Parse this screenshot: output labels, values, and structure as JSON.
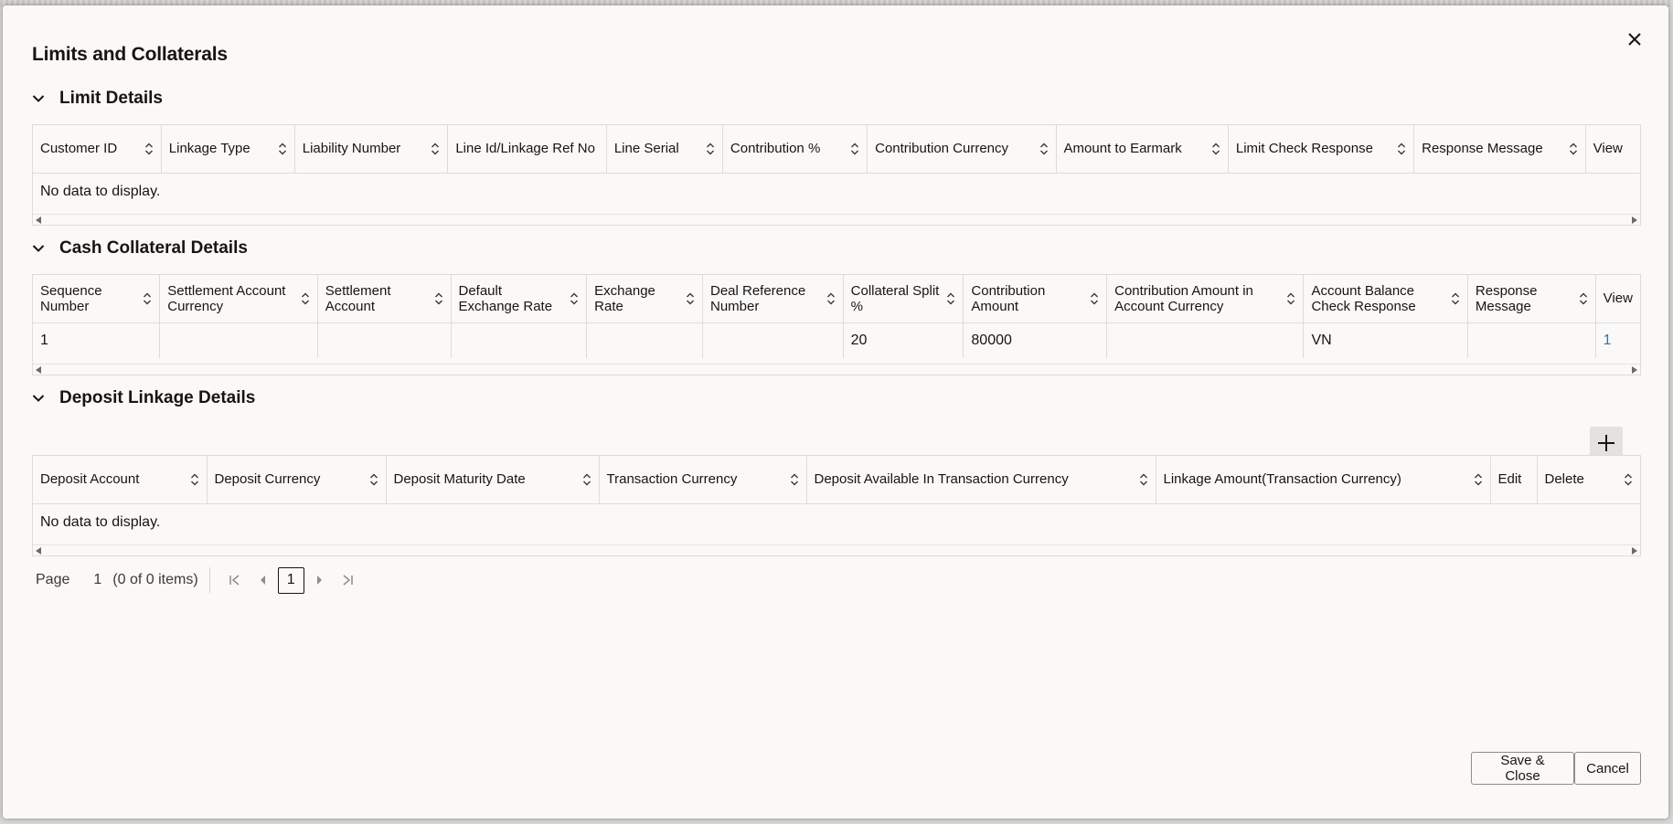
{
  "dialog": {
    "title": "Limits and Collaterals",
    "save_close_label": "Save & Close",
    "cancel_label": "Cancel"
  },
  "limit_details": {
    "title": "Limit Details",
    "columns": [
      "Customer ID",
      "Linkage Type",
      "Liability Number",
      "Line Id/Linkage Ref No",
      "Line Serial",
      "Contribution %",
      "Contribution Currency",
      "Amount to Earmark",
      "Limit Check Response",
      "Response Message",
      "View"
    ],
    "empty_text": "No data to display."
  },
  "cash_collateral": {
    "title": "Cash Collateral Details",
    "columns": [
      "Sequence Number",
      "Settlement Account Currency",
      "Settlement Account",
      "Default Exchange Rate",
      "Exchange Rate",
      "Deal Reference Number",
      "Collateral Split %",
      "Contribution Amount",
      "Contribution Amount in Account Currency",
      "Account Balance Check Response",
      "Response Message",
      "View"
    ],
    "rows": [
      [
        "1",
        "",
        "",
        "",
        "",
        "",
        "20",
        "80000",
        "",
        "VN",
        "",
        "1"
      ]
    ]
  },
  "deposit_linkage": {
    "title": "Deposit Linkage Details",
    "columns": [
      "Deposit Account",
      "Deposit Currency",
      "Deposit Maturity Date",
      "Transaction Currency",
      "Deposit Available In Transaction Currency",
      "Linkage Amount(Transaction Currency)",
      "Edit",
      "Delete"
    ],
    "empty_text": "No data to display."
  },
  "pager": {
    "page_label": "Page",
    "page_value": "1",
    "items_text": "(0 of 0 items)",
    "current_page": "1"
  },
  "colors": {
    "dialog_bg": "#fbf9f8",
    "link": "#227ab7",
    "border": "#dedcda"
  }
}
